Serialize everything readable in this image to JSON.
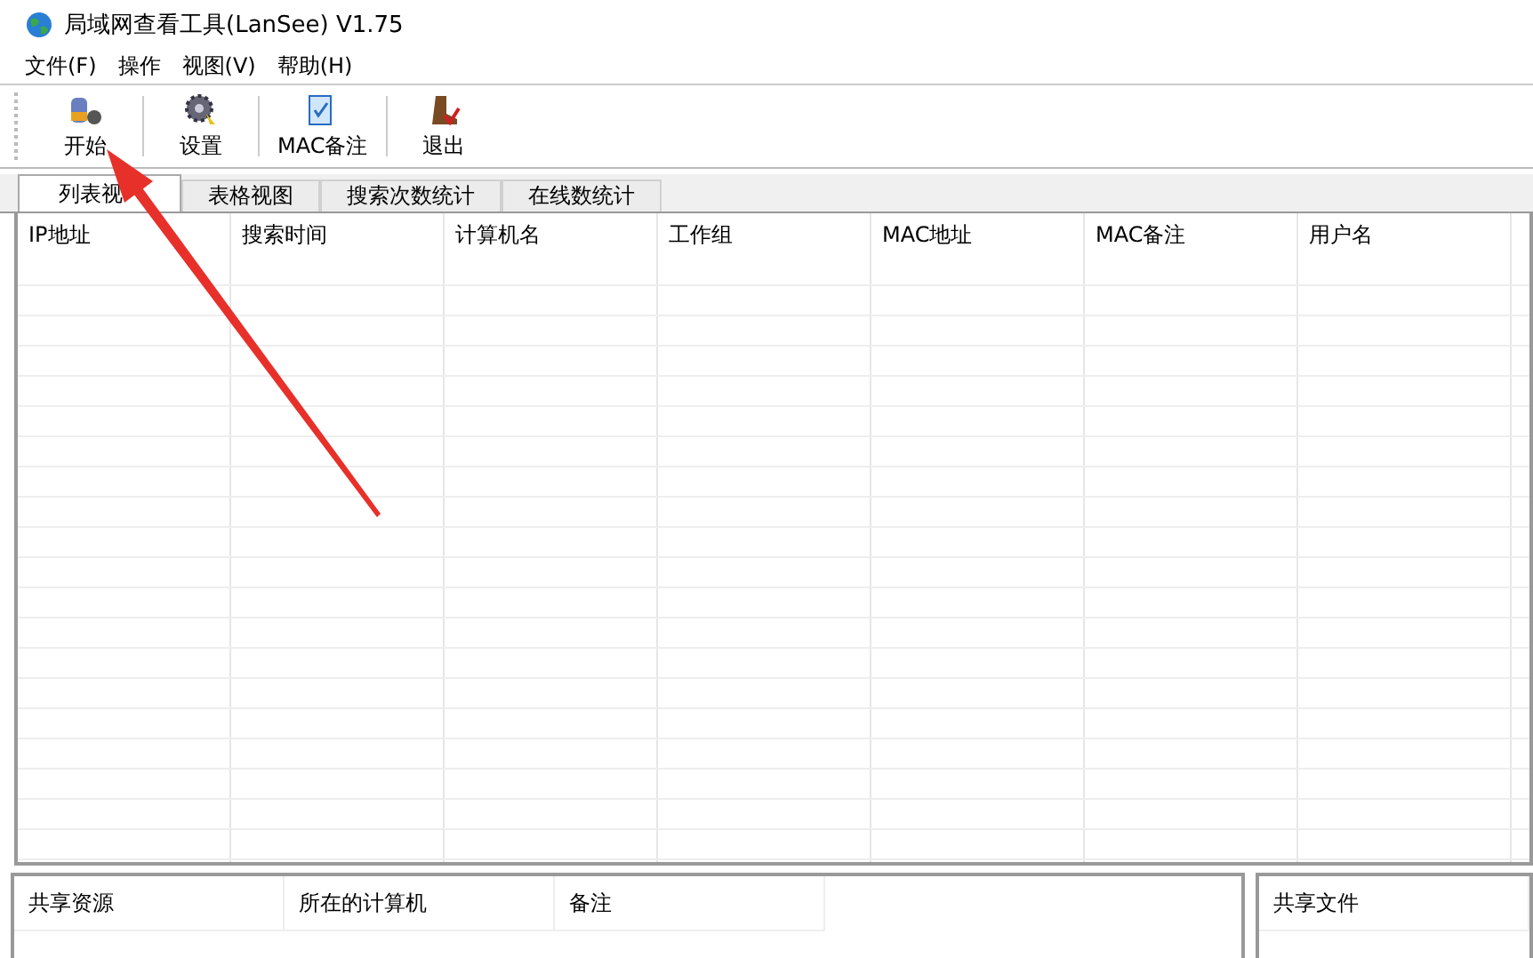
{
  "window": {
    "title": "局域网查看工具(LanSee) V1.75"
  },
  "menu": [
    "文件(F)",
    "操作",
    "视图(V)",
    "帮助(H)"
  ],
  "toolbar": [
    {
      "label": "开始",
      "kind": "start"
    },
    {
      "label": "设置",
      "kind": "settings"
    },
    {
      "label": "MAC备注",
      "kind": "note"
    },
    {
      "label": "退出",
      "kind": "exit"
    }
  ],
  "tabs": [
    {
      "label": "列表视",
      "selected": true
    },
    {
      "label": "表格视图",
      "selected": false
    },
    {
      "label": "搜索次数统计",
      "selected": false
    },
    {
      "label": "在线数统计",
      "selected": false
    }
  ],
  "table": {
    "columns": [
      "IP地址",
      "搜索时间",
      "计算机名",
      "工作组",
      "MAC地址",
      "MAC备注",
      "用户名"
    ]
  },
  "shares": {
    "columns": [
      "共享资源",
      "所在的计算机",
      "备注"
    ]
  },
  "files": {
    "columns": [
      "共享文件"
    ]
  }
}
